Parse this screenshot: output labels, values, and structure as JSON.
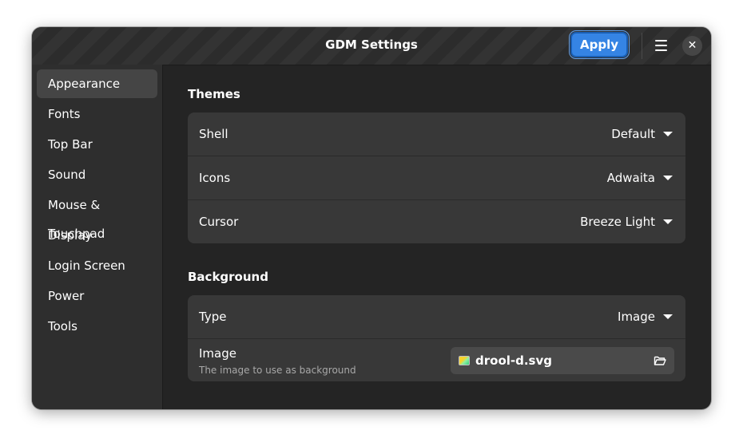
{
  "window": {
    "title": "GDM Settings",
    "apply_label": "Apply",
    "close_glyph": "✕"
  },
  "sidebar": {
    "items": [
      {
        "label": "Appearance",
        "active": true
      },
      {
        "label": "Fonts"
      },
      {
        "label": "Top Bar"
      },
      {
        "label": "Sound"
      },
      {
        "label": "Mouse & Touchpad"
      },
      {
        "label": "Display"
      },
      {
        "label": "Login Screen"
      },
      {
        "label": "Power"
      },
      {
        "label": "Tools"
      }
    ]
  },
  "themes": {
    "title": "Themes",
    "rows": [
      {
        "label": "Shell",
        "value": "Default"
      },
      {
        "label": "Icons",
        "value": "Adwaita"
      },
      {
        "label": "Cursor",
        "value": "Breeze Light"
      }
    ]
  },
  "background": {
    "title": "Background",
    "type_label": "Type",
    "type_value": "Image",
    "image_label": "Image",
    "image_sublabel": "The image to use as background",
    "image_file": "drool-d.svg"
  },
  "colors": {
    "accent": "#3584e4",
    "window_bg": "#242424",
    "sidebar_bg": "#2e2e2e",
    "card_bg": "#383838"
  },
  "icons": {
    "menu": "hamburger-menu-icon",
    "close": "close-icon",
    "dropdown": "chevron-down-icon",
    "file": "image-file-icon",
    "folder": "folder-open-icon"
  }
}
